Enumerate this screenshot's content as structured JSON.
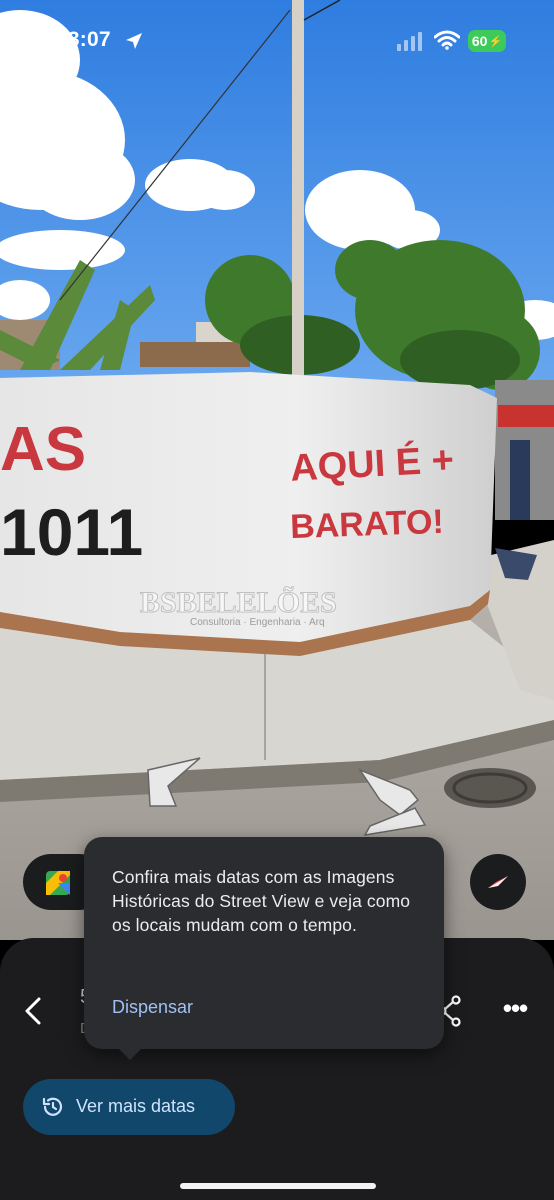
{
  "status_bar": {
    "time": "23:07",
    "battery": "60",
    "icons": [
      "location-arrow-icon",
      "cellular-signal-icon",
      "wifi-icon",
      "battery-charging-icon"
    ]
  },
  "street_view": {
    "wall_text_left_top": "AS",
    "wall_text_left_bottom": "1011",
    "wall_text_right_top": "AQUI É +",
    "wall_text_right_bottom": "BARATO!",
    "watermark": "BSBELELÕES",
    "watermark_small": "Consultoria · Engenharia · Arq"
  },
  "controls": {
    "maps_icon": "google-maps-icon",
    "compass_icon": "compass-icon"
  },
  "tooltip": {
    "text": "Confira mais datas com as Imagens Históricas do Street View e veja como os locais mudam com o tempo.",
    "dismiss_label": "Dispensar"
  },
  "sheet": {
    "partial_title": "5",
    "partial_subtitle": "D",
    "history_button_label": "Ver mais datas"
  },
  "colors": {
    "sheet_bg": "#1c1c1e",
    "tooltip_bg": "#2b2c2f",
    "link_blue": "#9ec1f4",
    "history_btn_bg": "#10476a",
    "battery_green": "#3ccb5a",
    "wall_red": "#c9373f"
  }
}
